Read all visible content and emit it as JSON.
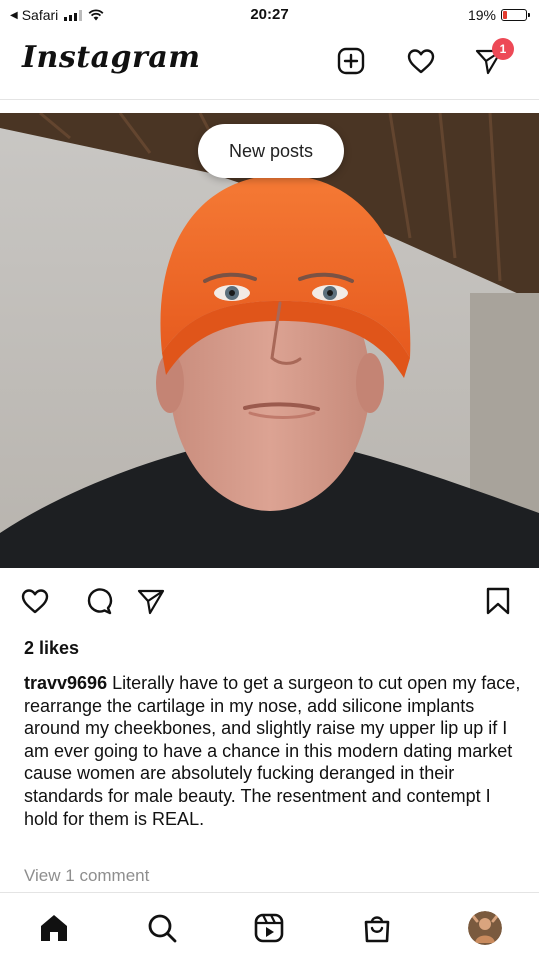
{
  "status_bar": {
    "back_app": "Safari",
    "time": "20:27",
    "battery": "19%",
    "battery_level": 0.19
  },
  "header": {
    "logo_text": "Instagram",
    "icons": [
      "plus-square-icon",
      "heart-icon",
      "direct-message-icon"
    ],
    "dm_badge": "1"
  },
  "feed": {
    "new_posts_label": "New posts",
    "post": {
      "likes": "2 likes",
      "username": "travv9696",
      "caption": "Literally have to get a surgeon to cut open my face, rearrange the cartilage in my nose, add silicone implants around my cheekbones, and slightly raise my upper lip up if I am ever going to have a chance in this modern dating market cause women are absolutely fucking deranged in their standards for male beauty. The resentment and contempt I hold for them is REAL.",
      "view_comments": "View 1 comment",
      "action_icons": [
        "heart-icon",
        "comment-icon",
        "share-icon",
        "bookmark-icon"
      ]
    }
  },
  "bottom_nav": {
    "items": [
      "home-icon",
      "search-icon",
      "reels-icon",
      "shop-icon",
      "profile-avatar"
    ]
  },
  "colors": {
    "badge": "#ed4956",
    "beanie": "#f26b2a",
    "battery_low": "#e23b2f",
    "muted_text": "#8e8e8e"
  }
}
